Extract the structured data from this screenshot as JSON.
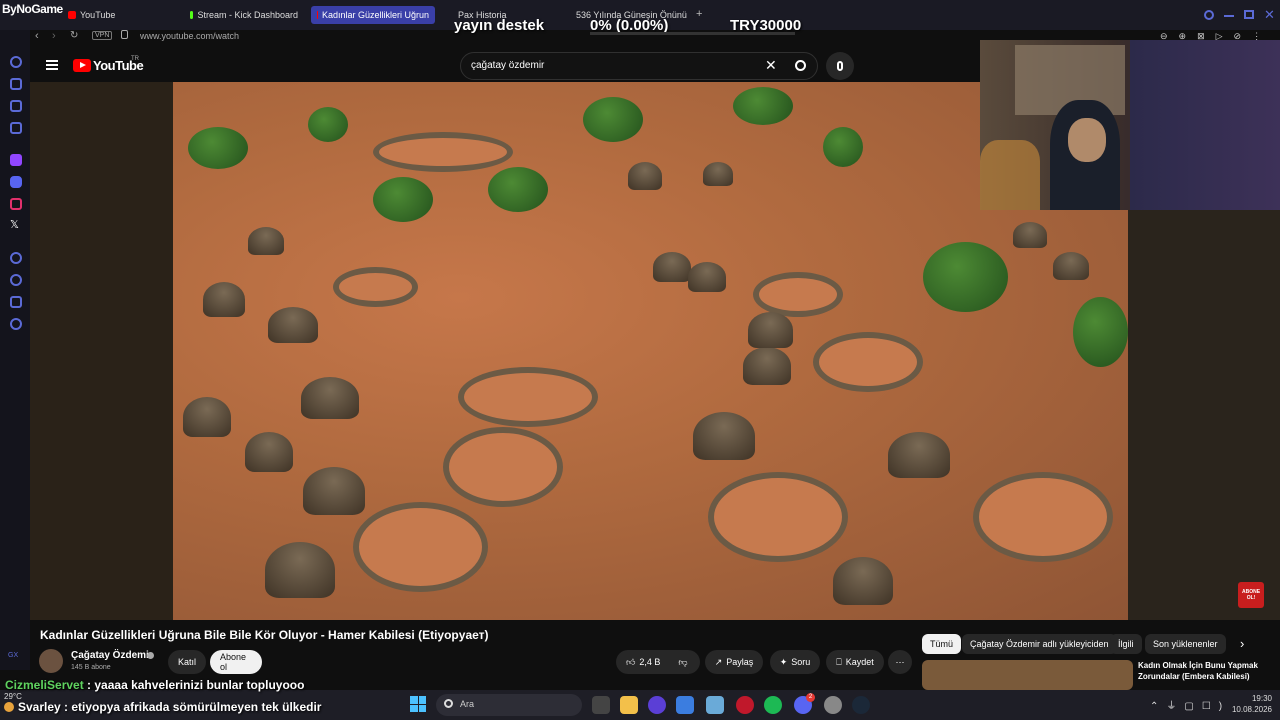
{
  "overlay": {
    "brand": "ByNoGame",
    "yayin_destek": "yayın destek",
    "percent": "0% (0.00%)",
    "goal": "TRY30000"
  },
  "browser": {
    "tabs": [
      {
        "label": "YouTube",
        "active": false
      },
      {
        "label": "Stream - Kick Dashboard",
        "active": false
      },
      {
        "label": "Kadınlar Güzellikleri Uğrun",
        "active": true
      },
      {
        "label": "Pax Historia",
        "active": false
      },
      {
        "label": "536 Yılında Güneşin Önünü",
        "active": false
      }
    ],
    "new_tab": "+",
    "vpn_badge": "VPN",
    "url": "www.youtube.com/watch"
  },
  "youtube": {
    "logo": "YouTube",
    "region": "TR",
    "search_value": "çağatay özdemir",
    "video_title": "Kadınlar Güzellikleri Uğruna Bile Bile Kör Oluyor - Hamer Kabilesi (Etiyopyaет)",
    "channel_name": "Çağatay Özdemir",
    "subscribers": "145 B abone",
    "join_label": "Katıl",
    "subscribe_label": "Abone ol",
    "like_count": "2,4 B",
    "share_label": "Paylaş",
    "ask_label": "Soru",
    "save_label": "Kaydet",
    "more_label": "⋯",
    "abone_badge": "ABONE OL!",
    "chips": [
      "Tümü",
      "Çağatay Özdemir adlı yükleyiciden",
      "İlgili",
      "Son yüklenenler"
    ],
    "rec_title": "Kadın Olmak İçin Bunu Yapmak Zorundalar (Embera Kabilesi)"
  },
  "chat": [
    {
      "user": "CizmeliServet",
      "message": "yaaaa kahvelerinizi bunlar topluyooo",
      "user_color": "#5fd35f"
    },
    {
      "user": "Svarley",
      "message": "etiyopya afrikada sömürülmeyen tek ülkedir",
      "user_color": "#ffffff"
    }
  ],
  "taskbar": {
    "weather": "29°C",
    "search_placeholder": "Ara",
    "time": "19:30",
    "date": "10.08.2026",
    "discord_badge": "2"
  },
  "colors": {
    "accent": "#3a3fa8",
    "youtube_red": "#ff0000",
    "rail_icon": "#5b6ad6"
  }
}
